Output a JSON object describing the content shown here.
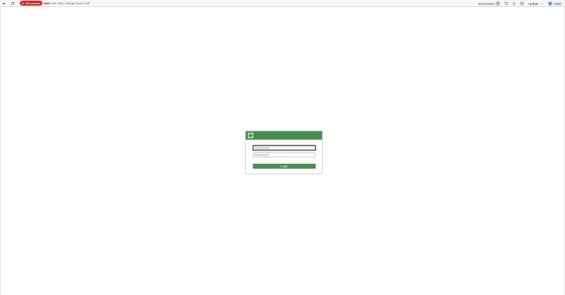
{
  "browser": {
    "security_label": "Not secure",
    "url_scheme": "https",
    "url_rest": "://192.168.1.99/login?redir=%2F",
    "summarize_label": "Summarize",
    "update_label": "Update",
    "update_more": "···",
    "chat_label": "Chat",
    "icons": {
      "back": "arrow-left-icon",
      "reload": "reload-icon",
      "security": "warning-icon",
      "summarize": "summarize-icon",
      "sync": "sync-icon",
      "favorites": "star-icon",
      "extension": "avatar-icon",
      "chat": "chat-logo-icon"
    }
  },
  "login": {
    "header_color": "#4a8c50",
    "logo": "cross-logo-icon",
    "username_placeholder": "Username",
    "password_placeholder": "Password",
    "submit_label": "Login"
  }
}
